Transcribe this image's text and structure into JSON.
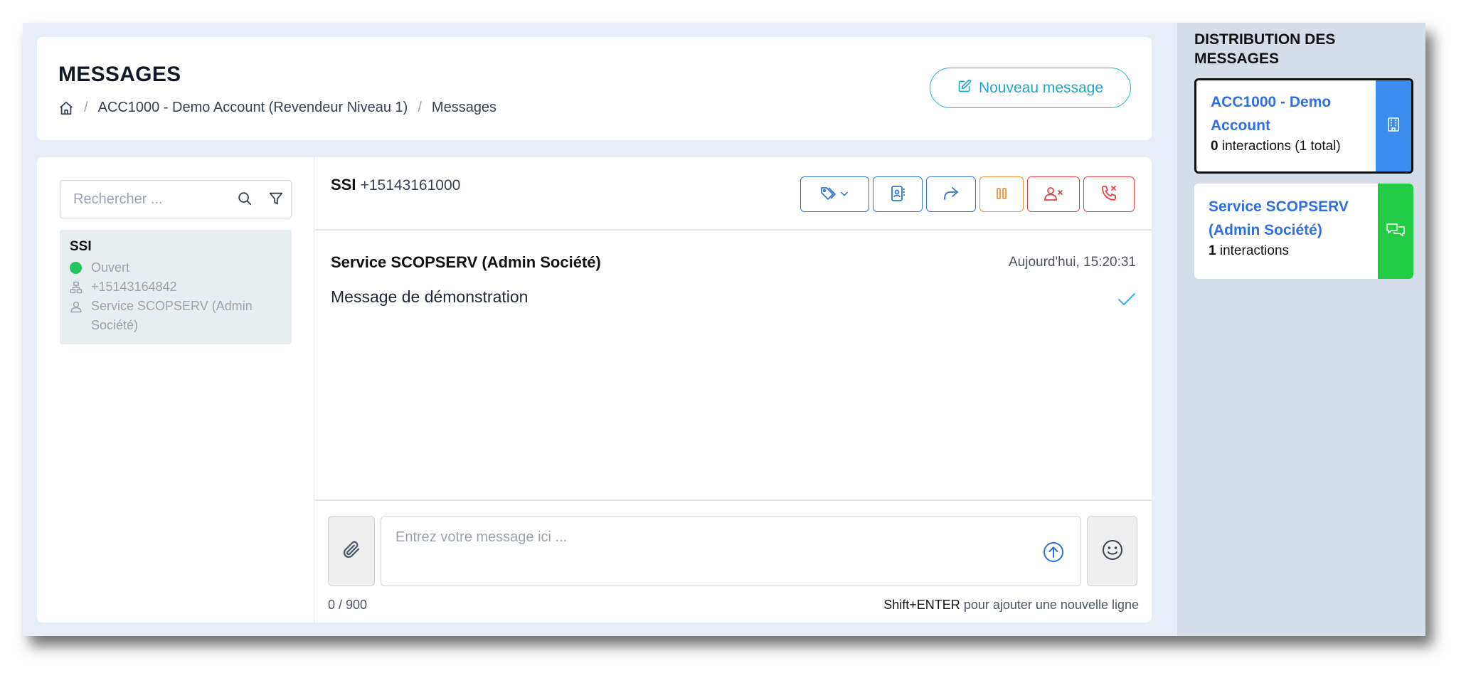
{
  "header": {
    "title": "MESSAGES",
    "breadcrumb": [
      "ACC1000 - Demo Account (Revendeur Niveau 1)",
      "Messages"
    ],
    "new_message_label": "Nouveau message"
  },
  "sidebar": {
    "search_placeholder": "Rechercher ...",
    "conversations": [
      {
        "name": "SSI",
        "status": "Ouvert",
        "status_color": "#22c55e",
        "phone": "+15143164842",
        "assignee": "Service SCOPSERV (Admin Société)"
      }
    ]
  },
  "conversation": {
    "name": "SSI",
    "number": "+15143161000",
    "actions": [
      "tag-icon",
      "contact-card-icon",
      "forward-icon",
      "pause-icon",
      "remove-user-icon",
      "end-call-icon"
    ],
    "messages": [
      {
        "sender": "Service SCOPSERV (Admin Société)",
        "time": "Aujourd'hui, 15:20:31",
        "text": "Message de démonstration"
      }
    ]
  },
  "composer": {
    "placeholder": "Entrez votre message ici ...",
    "char_count": "0 / 900",
    "hint_key": "Shift+ENTER",
    "hint_text": " pour ajouter une nouvelle ligne"
  },
  "distribution": {
    "title": "DISTRIBUTION DES MESSAGES",
    "items": [
      {
        "name": "ACC1000 - Demo Account",
        "count": "0",
        "count_text": " interactions (1 total)",
        "color": "#3b8ef0"
      },
      {
        "name": "Service SCOPSERV (Admin Société)",
        "count": "1",
        "count_text": " interactions",
        "color": "#22cc44"
      }
    ]
  },
  "colors": {
    "accent": "#22b3d4",
    "link_blue": "#2f6fe0",
    "action_blue": "#2f73d6",
    "orange": "#f0913a",
    "red": "#e04646"
  }
}
